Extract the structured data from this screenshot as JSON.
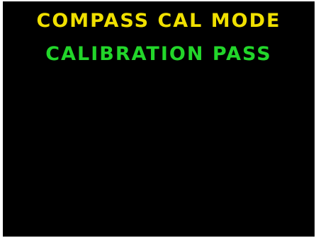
{
  "display": {
    "mode_title": "COMPASS CAL MODE",
    "status": "CALIBRATION PASS",
    "colors": {
      "background": "#000000",
      "mode_title": "#f0e000",
      "status": "#22d62a"
    }
  }
}
